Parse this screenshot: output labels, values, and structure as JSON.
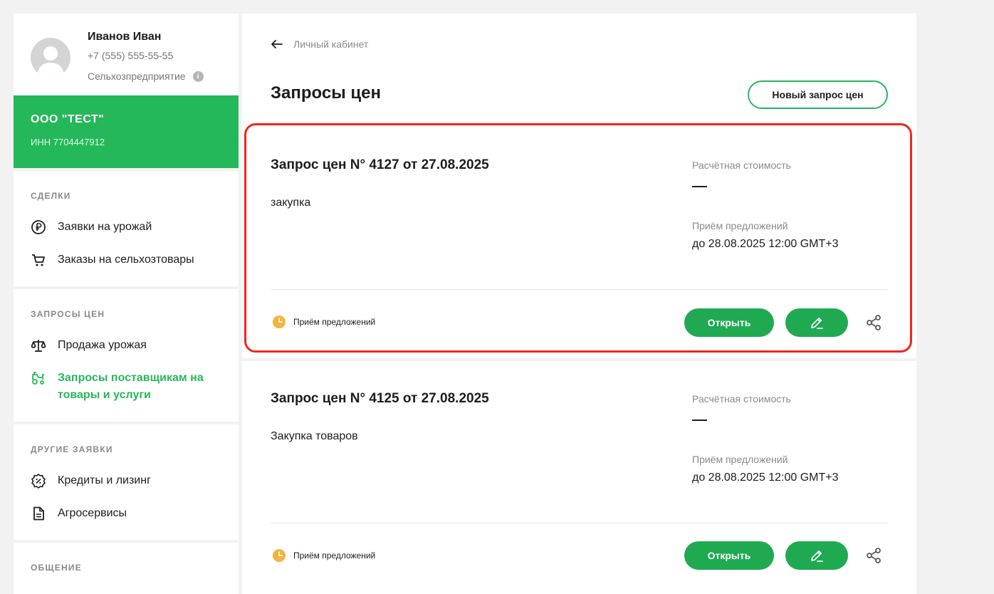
{
  "user": {
    "name": "Иванов Иван",
    "phone": "+7 (555) 555-55-55",
    "role": "Сельхозпредприятие",
    "info_icon": "i"
  },
  "company": {
    "name": "ООО \"ТЕСТ\"",
    "inn": "ИНН 7704447912",
    "color": "#25b85a"
  },
  "sidebar": {
    "sections": [
      {
        "title": "СДЕЛКИ",
        "items": [
          {
            "label": "Заявки на урожай",
            "icon": "ruble-coin-icon"
          },
          {
            "label": "Заказы на сельхозтовары",
            "icon": "cart-icon"
          }
        ]
      },
      {
        "title": "ЗАПРОСЫ ЦЕН",
        "items": [
          {
            "label": "Продажа урожая",
            "icon": "scales-icon"
          },
          {
            "label": "Запросы поставщикам на товары и услуги",
            "icon": "tractor-icon",
            "active": true
          }
        ]
      },
      {
        "title": "ДРУГИЕ ЗАЯВКИ",
        "items": [
          {
            "label": "Кредиты и лизинг",
            "icon": "percent-badge-icon"
          },
          {
            "label": "Агросервисы",
            "icon": "document-icon"
          }
        ]
      },
      {
        "title": "ОБЩЕНИЕ",
        "items": []
      }
    ]
  },
  "main": {
    "breadcrumb": "Личный кабинет",
    "title": "Запросы цен",
    "new_request_label": "Новый запрос цен",
    "requests": [
      {
        "title": "Запрос цен N° 4127 от 27.08.2025",
        "description": "закупка",
        "cost_label": "Расчётная стоимость",
        "cost_value": "—",
        "offers_label": "Приём предложений",
        "offers_value": "до 28.08.2025 12:00 GMT+3",
        "status": "Приём предложений",
        "open_label": "Открыть"
      },
      {
        "title": "Запрос цен N° 4125 от 27.08.2025",
        "description": "Закупка товаров",
        "cost_label": "Расчётная стоимость",
        "cost_value": "—",
        "offers_label": "Приём предложений",
        "offers_value": "до 28.08.2025 12:00 GMT+3",
        "status": "Приём предложений",
        "open_label": "Открыть"
      }
    ]
  },
  "colors": {
    "accent": "#25b85a",
    "button": "#1faa52",
    "highlight": "#f2261b",
    "status_clock": "#f3b43c"
  }
}
